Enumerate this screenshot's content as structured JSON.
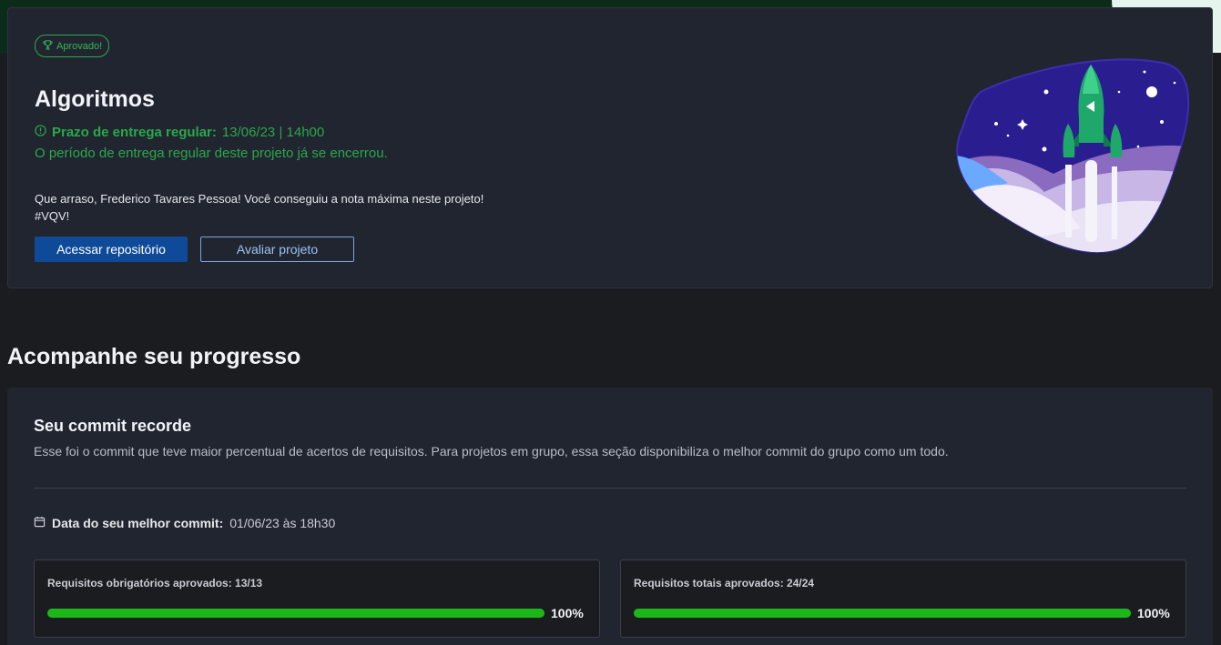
{
  "project": {
    "badge": "Aprovado!",
    "title": "Algoritmos",
    "deadline_label": "Prazo de entrega regular:",
    "deadline_value": "13/06/23 | 14h00",
    "deadline_note": "O período de entrega regular deste projeto já se encerrou.",
    "message_line1": "Que arraso, Frederico Tavares Pessoa! Você conseguiu a nota máxima neste projeto!",
    "message_line2": "#VQV!",
    "repo_button": "Acessar repositório",
    "rate_button": "Avaliar projeto"
  },
  "progress": {
    "section_title": "Acompanhe seu progresso",
    "card_title": "Seu commit recorde",
    "card_description": "Esse foi o commit que teve maior percentual de acertos de requisitos. Para projetos em grupo, essa seção disponibiliza o melhor commit do grupo como um todo.",
    "best_commit_label": "Data do seu melhor commit:",
    "best_commit_value": "01/06/23 às 18h30",
    "requirements": [
      {
        "label": "Requisitos obrigatórios aprovados: 13/13",
        "percent_text": "100%",
        "fraction": 1.0
      },
      {
        "label": "Requisitos totais aprovados: 24/24",
        "percent_text": "100%",
        "fraction": 1.0
      }
    ]
  },
  "colors": {
    "success": "#2aa84a",
    "primary_button": "#0f4a99",
    "progress_fill": "#1cb81a",
    "card_bg": "#212530"
  },
  "icons": [
    "trophy-icon",
    "clock-alert-icon",
    "calendar-icon",
    "rocket-illustration"
  ]
}
